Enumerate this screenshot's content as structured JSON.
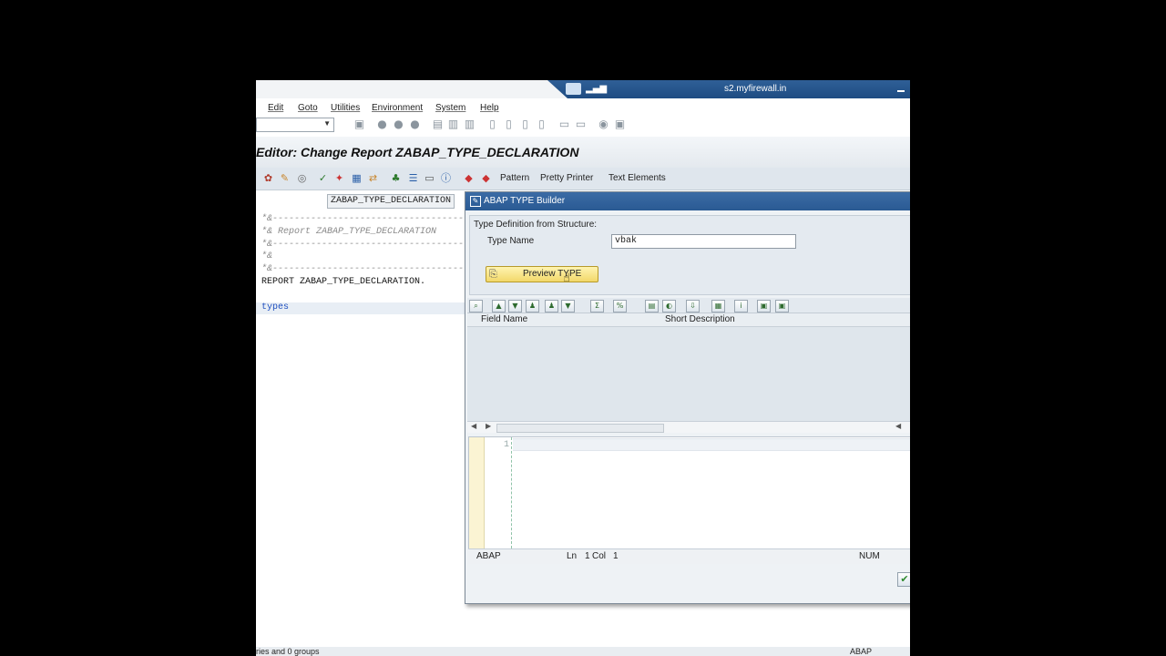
{
  "connection": {
    "host": "s2.myfirewall.in",
    "signal_glyph": "▂▄▆"
  },
  "menu": [
    "Edit",
    "Goto",
    "Utilities",
    "Environment",
    "System",
    "Help"
  ],
  "window": {
    "title": "Editor: Change Report ZABAP_TYPE_DECLARATION"
  },
  "app_toolbar": {
    "pattern": "Pattern",
    "pretty_printer": "Pretty Printer",
    "text_elements": "Text Elements"
  },
  "editor": {
    "program_name": "ZABAP_TYPE_DECLARATION",
    "lines": [
      {
        "text": "*&---------------------------------------------------------------------",
        "kind": "comment"
      },
      {
        "text": "*& Report ZABAP_TYPE_DECLARATION",
        "kind": "comment"
      },
      {
        "text": "*&---------------------------------------------------------------------",
        "kind": "comment"
      },
      {
        "text": "*&",
        "kind": "comment"
      },
      {
        "text": "*&---------------------------------------------------------------------",
        "kind": "comment"
      },
      {
        "text": "REPORT ZABAP_TYPE_DECLARATION.",
        "kind": "keyword"
      },
      {
        "text": "",
        "kind": "blank"
      },
      {
        "text": "types",
        "kind": "types"
      }
    ]
  },
  "dialog": {
    "title": "ABAP TYPE Builder",
    "section_header": "Type Definition from Structure:",
    "type_name_label": "Type Name",
    "type_name_value": "vbak",
    "preview_button": "Preview TYPE",
    "grid_columns": [
      "Field Name",
      "Short Description"
    ],
    "code_line_number": "1",
    "status": {
      "language": "ABAP",
      "ln_label": "Ln",
      "ln_value": "1",
      "col_label": "Col",
      "col_value": "1",
      "num": "NUM"
    }
  },
  "bottom_status": {
    "left": "ries and 0 groups",
    "right": "ABAP"
  }
}
